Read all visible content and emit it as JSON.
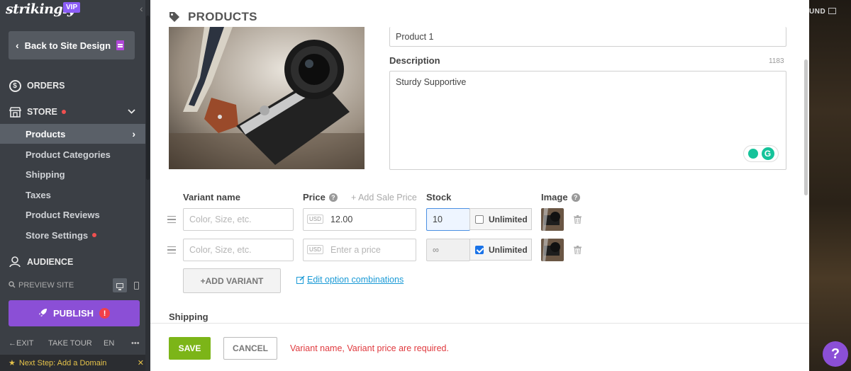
{
  "brand": {
    "name": "strikingly",
    "badge": "VIP"
  },
  "sidebar": {
    "back_label": "Back to Site Design",
    "orders_label": "ORDERS",
    "store_label": "STORE",
    "audience_label": "AUDIENCE",
    "store_items": [
      {
        "label": "Products",
        "active": true
      },
      {
        "label": "Product Categories"
      },
      {
        "label": "Shipping"
      },
      {
        "label": "Taxes"
      },
      {
        "label": "Product Reviews"
      },
      {
        "label": "Store Settings",
        "has_dot": true
      }
    ],
    "preview_label": "PREVIEW SITE",
    "publish_label": "PUBLISH",
    "bottom": {
      "exit": "EXIT",
      "tour": "TAKE TOUR",
      "lang": "EN",
      "more": "•••"
    },
    "next_step": "Next Step: Add a Domain"
  },
  "panel": {
    "title": "PRODUCTS",
    "product_name_value": "Product 1",
    "description_label": "Description",
    "char_count": "1183",
    "description_value": "Sturdy Supportive",
    "table_headers": {
      "variant_name": "Variant name",
      "price": "Price",
      "add_sale_price": "+ Add Sale Price",
      "stock": "Stock",
      "image": "Image"
    },
    "variants": [
      {
        "name_placeholder": "Color, Size, etc.",
        "currency": "USD",
        "price": "12.00",
        "stock": "10",
        "unlimited": false,
        "unlimited_label": "Unlimited"
      },
      {
        "name_placeholder": "Color, Size, etc.",
        "currency": "USD",
        "price_placeholder": "Enter a price",
        "stock": "∞",
        "unlimited": true,
        "unlimited_label": "Unlimited"
      }
    ],
    "add_variant_label": "+ADD VARIANT",
    "edit_combinations_label": "Edit option combinations",
    "shipping_label": "Shipping",
    "save_label": "SAVE",
    "cancel_label": "CANCEL",
    "error_message": "Variant name, Variant price are required."
  },
  "preview_strip": {
    "text": "UND"
  },
  "help_label": "?",
  "colors": {
    "publish": "#8b4fd6",
    "save": "#7cb518",
    "error": "#e0393e",
    "link": "#1a9ad6"
  }
}
